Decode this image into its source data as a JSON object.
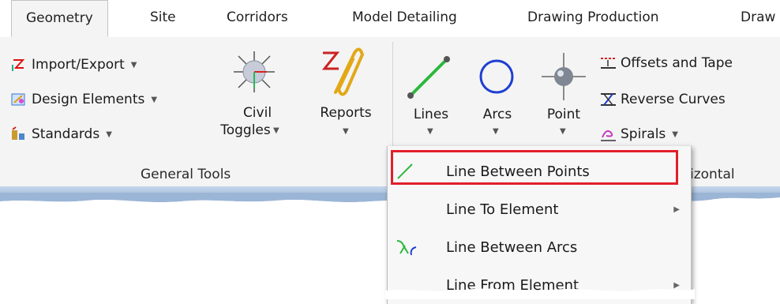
{
  "tabs": [
    {
      "label": "Geometry",
      "active": true
    },
    {
      "label": "Site"
    },
    {
      "label": "Corridors"
    },
    {
      "label": "Model Detailing"
    },
    {
      "label": "Drawing Production"
    },
    {
      "label": "Draw"
    }
  ],
  "general_tools": {
    "items": [
      {
        "label": "Import/Export",
        "icon": "import-export-icon"
      },
      {
        "label": "Design Elements",
        "icon": "design-elements-icon"
      },
      {
        "label": "Standards",
        "icon": "standards-icon"
      }
    ],
    "civil_toggles": {
      "line1": "Civil",
      "line2": "Toggles"
    },
    "reports": "Reports",
    "group_label": "General Tools"
  },
  "horizontal": {
    "lines": "Lines",
    "arcs": "Arcs",
    "point": "Point",
    "items": [
      {
        "label": "Offsets and Tape",
        "icon": "offsets-tapers-icon"
      },
      {
        "label": "Reverse Curves",
        "icon": "reverse-curves-icon"
      },
      {
        "label": "Spirals",
        "icon": "spirals-icon"
      }
    ],
    "group_label_partial": "izontal"
  },
  "lines_menu": {
    "items": [
      {
        "label": "Line Between Points",
        "highlighted": true
      },
      {
        "label": "Line To Element",
        "submenu": true
      },
      {
        "label": "Line Between Arcs"
      },
      {
        "label": "Line From Element",
        "submenu": true
      }
    ]
  },
  "colors": {
    "highlight_border": "#e0202a",
    "line_icon": "#2db83d",
    "arc_icon": "#1f3fd1"
  }
}
